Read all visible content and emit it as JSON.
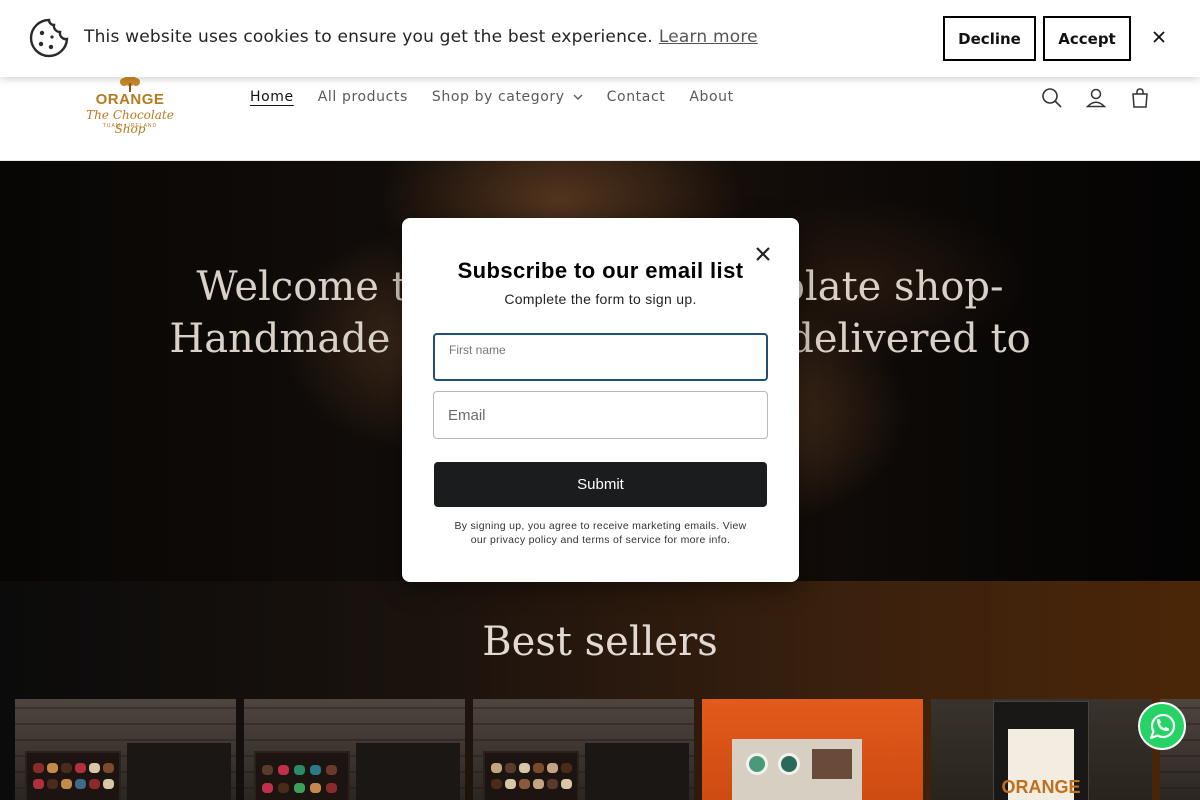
{
  "cookie_banner": {
    "message": "This website uses cookies to ensure you get the best experience.",
    "learn_more": "Learn more",
    "decline": "Decline",
    "accept": "Accept",
    "close_symbol": "×"
  },
  "header": {
    "logo": {
      "line1": "ORANGE",
      "line2": "The Chocolate Shop",
      "line3": "TUAM · IRELAND"
    },
    "nav": [
      {
        "label": "Home",
        "active": true
      },
      {
        "label": "All products"
      },
      {
        "label": "Shop by category",
        "has_dropdown": true
      },
      {
        "label": "Contact"
      },
      {
        "label": "About"
      }
    ],
    "icons": [
      "search-icon",
      "account-icon",
      "cart-icon"
    ]
  },
  "hero": {
    "title": "Welcome to the Orange chocolate shop- Handmade chocolates, locally delivered to"
  },
  "best_sellers": {
    "title": "Best sellers"
  },
  "popup": {
    "title": "Subscribe to our email list",
    "subtitle": "Complete the form to sign up.",
    "first_name_label": "First name",
    "first_name_value": "",
    "email_placeholder": "Email",
    "submit": "Submit",
    "disclaimer": "By signing up, you agree to receive marketing emails. View our privacy policy and terms of service for more info."
  },
  "colors": {
    "accent_border": "#1f4e79",
    "submit_bg": "#1b1c1e",
    "logo_gold": "#b97a1e",
    "whatsapp_green": "#25d366"
  }
}
